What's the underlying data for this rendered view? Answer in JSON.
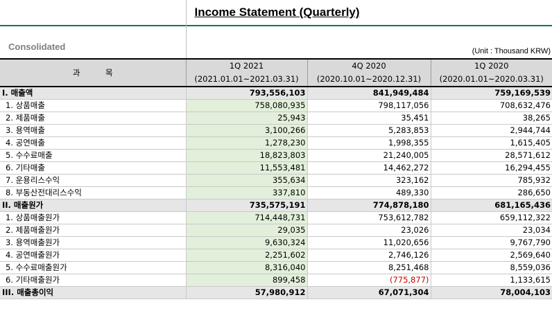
{
  "title": "Income Statement (Quarterly)",
  "scope_label": "Consolidated",
  "unit_label": "(Unit : Thousand KRW)",
  "header": {
    "item_col": "과          목",
    "periods": [
      {
        "name": "1Q 2021",
        "range": "(2021.01.01~2021.03.31)"
      },
      {
        "name": "4Q 2020",
        "range": "(2020.10.01~2020.12.31)"
      },
      {
        "name": "1Q 2020",
        "range": "(2020.01.01~2020.03.31)"
      }
    ]
  },
  "rows": [
    {
      "label": "I. 매출액",
      "values": [
        "793,556,103",
        "841,949,484",
        "759,169,539"
      ],
      "section": true
    },
    {
      "label": "1. 상품매출",
      "values": [
        "758,080,935",
        "798,117,056",
        "708,632,476"
      ]
    },
    {
      "label": "2. 제품매출",
      "values": [
        "25,943",
        "35,451",
        "38,265"
      ]
    },
    {
      "label": "3. 용역매출",
      "values": [
        "3,100,266",
        "5,283,853",
        "2,944,744"
      ]
    },
    {
      "label": "4. 공연매출",
      "values": [
        "1,278,230",
        "1,998,355",
        "1,615,405"
      ]
    },
    {
      "label": "5. 수수료매출",
      "values": [
        "18,823,803",
        "21,240,005",
        "28,571,612"
      ]
    },
    {
      "label": "6. 기타매출",
      "values": [
        "11,553,481",
        "14,462,272",
        "16,294,455"
      ]
    },
    {
      "label": "7. 운용리스수익",
      "values": [
        "355,634",
        "323,162",
        "785,932"
      ]
    },
    {
      "label": "8. 부동산전대리스수익",
      "values": [
        "337,810",
        "489,330",
        "286,650"
      ]
    },
    {
      "label": "II. 매출원가",
      "values": [
        "735,575,191",
        "774,878,180",
        "681,165,436"
      ],
      "section": true
    },
    {
      "label": "1. 상품매출원가",
      "values": [
        "714,448,731",
        "753,612,782",
        "659,112,322"
      ]
    },
    {
      "label": "2. 제품매출원가",
      "values": [
        "29,035",
        "23,026",
        "23,034"
      ]
    },
    {
      "label": "3. 용역매출원가",
      "values": [
        "9,630,324",
        "11,020,656",
        "9,767,790"
      ]
    },
    {
      "label": "4. 공연매출원가",
      "values": [
        "2,251,602",
        "2,746,126",
        "2,569,640"
      ]
    },
    {
      "label": "5. 수수료매출원가",
      "values": [
        "8,316,040",
        "8,251,468",
        "8,559,036"
      ]
    },
    {
      "label": "6. 기타매출원가",
      "values": [
        "899,458",
        "(775,877)",
        "1,133,615"
      ]
    },
    {
      "label": "III. 매출총이익",
      "values": [
        "57,980,912",
        "67,071,304",
        "78,004,103"
      ],
      "section": true
    }
  ],
  "colors": {
    "highlight": "#e2efda",
    "section_bg": "#e6e6e6",
    "header_bg": "#d9d9d9",
    "negative": "#d00000",
    "accent_line": "#0a7a45"
  }
}
